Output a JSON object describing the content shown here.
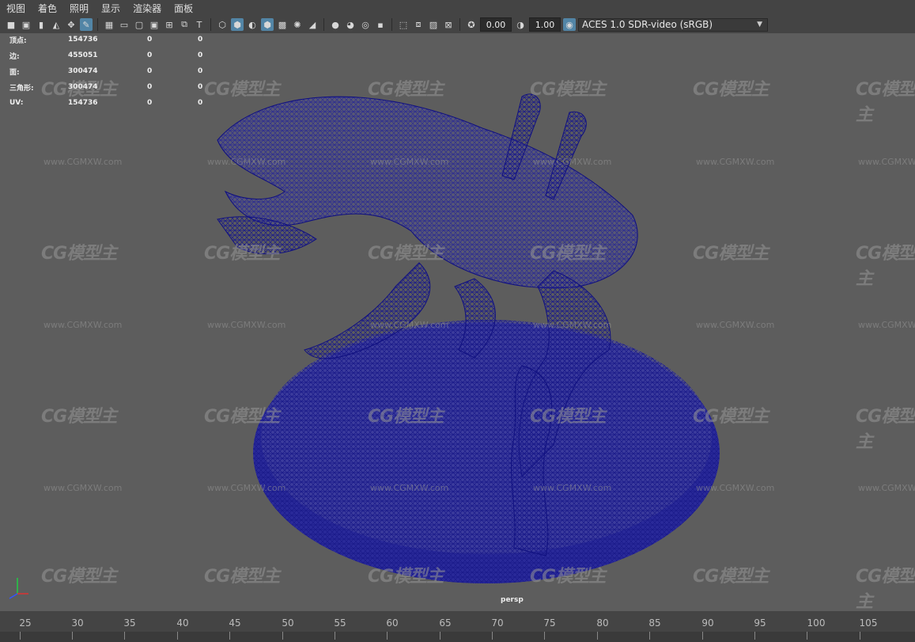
{
  "menu": [
    "视图",
    "着色",
    "照明",
    "显示",
    "渲染器",
    "面板"
  ],
  "toolbar": {
    "exposure": "0.00",
    "gamma": "1.00",
    "colorspace": "ACES 1.0 SDR-video (sRGB)"
  },
  "hud": [
    {
      "label": "顶点:",
      "v1": "154736",
      "v2": "0",
      "v3": "0"
    },
    {
      "label": "边:",
      "v1": "455051",
      "v2": "0",
      "v3": "0"
    },
    {
      "label": "面:",
      "v1": "300474",
      "v2": "0",
      "v3": "0"
    },
    {
      "label": "三角形:",
      "v1": "300474",
      "v2": "0",
      "v3": "0"
    },
    {
      "label": "UV:",
      "v1": "154736",
      "v2": "0",
      "v3": "0"
    }
  ],
  "watermark": {
    "logo": "CG模型主",
    "url": "www.CGMXW.com"
  },
  "camera_label": "persp",
  "timeline": {
    "ticks": [
      "25",
      "30",
      "35",
      "40",
      "45",
      "50",
      "55",
      "60",
      "65",
      "70",
      "75",
      "80",
      "85",
      "90",
      "95",
      "100",
      "105"
    ]
  }
}
